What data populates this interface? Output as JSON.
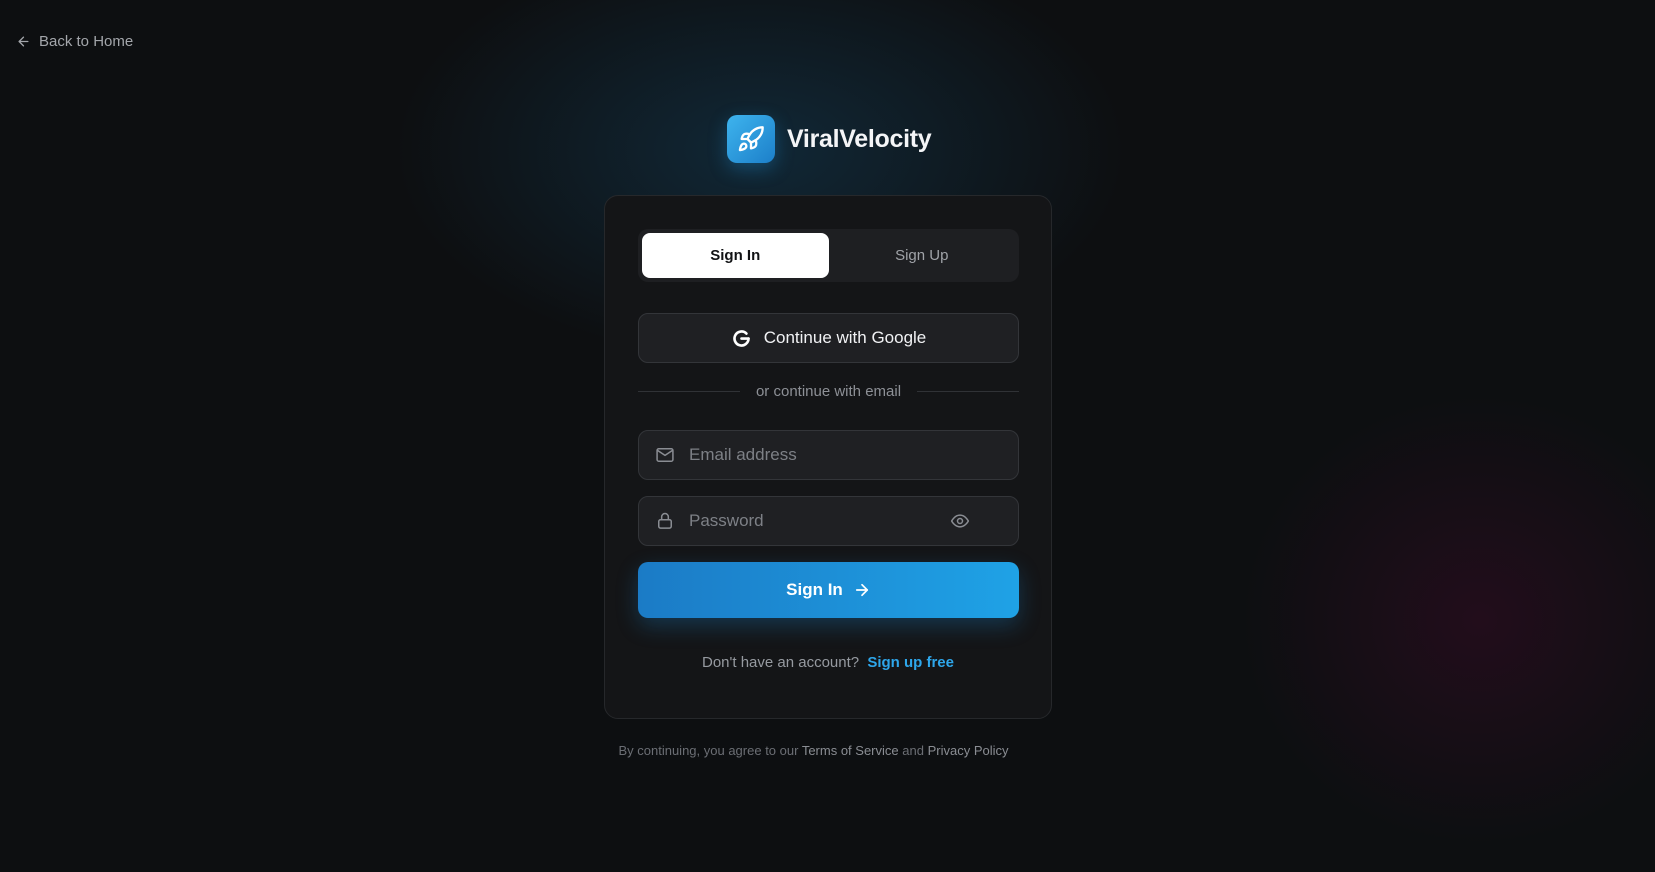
{
  "nav": {
    "back_label": "Back to Home"
  },
  "brand": {
    "name": "ViralVelocity"
  },
  "tabs": [
    {
      "label": "Sign In",
      "active": true
    },
    {
      "label": "Sign Up",
      "active": false
    }
  ],
  "google": {
    "label": "Continue with Google"
  },
  "divider": {
    "label": "or continue with email"
  },
  "form": {
    "email_placeholder": "Email address",
    "email_value": "",
    "password_placeholder": "Password",
    "password_value": "",
    "submit_label": "Sign In"
  },
  "switch_prompt": {
    "text": "Don't have an account?",
    "link": "Sign up free"
  },
  "legal": {
    "prefix": "By continuing, you agree to our",
    "terms": "Terms of Service",
    "and": "and",
    "privacy": "Privacy Policy"
  },
  "icons": {
    "back": "arrow-left-icon",
    "logo": "rocket-icon",
    "google": "google-icon",
    "email": "mail-icon",
    "password": "lock-icon",
    "toggle_password": "eye-icon",
    "submit": "arrow-right-icon"
  },
  "colors": {
    "accent": "#1fa2e6",
    "link": "#2ea6ea",
    "background": "#0d0f11",
    "card": "#141517"
  }
}
